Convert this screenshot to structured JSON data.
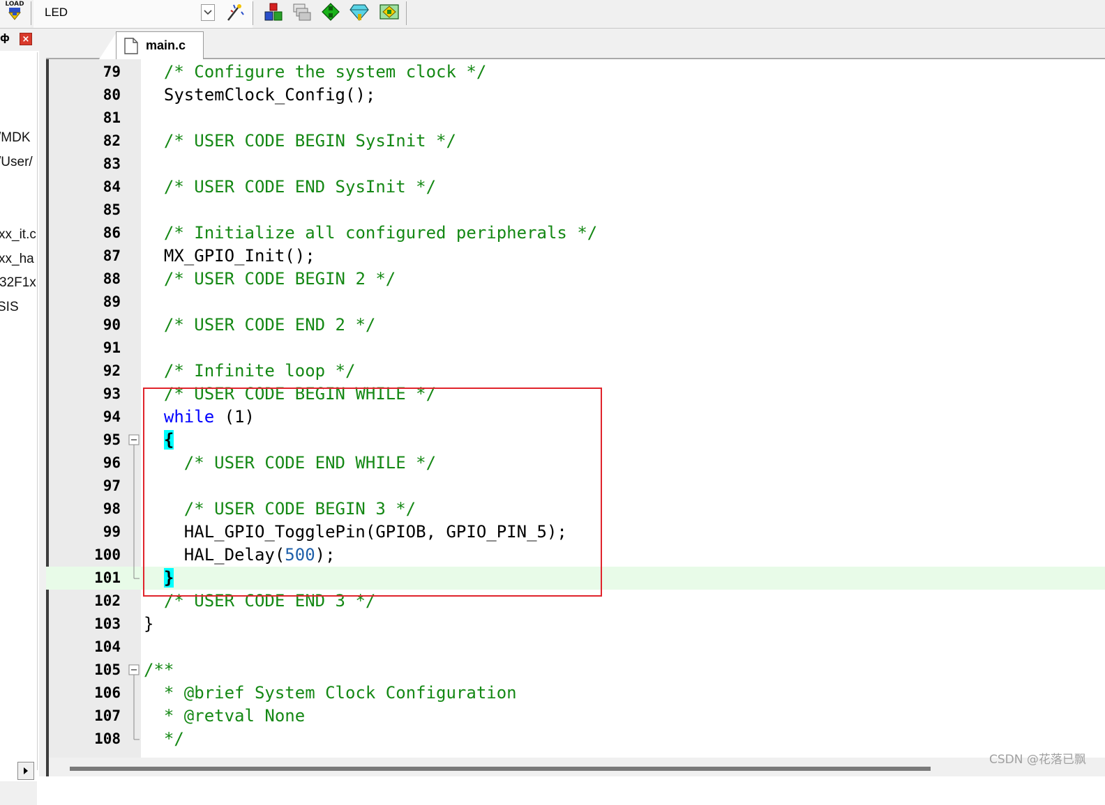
{
  "toolbar": {
    "load_label": "LOAD",
    "target_name": "LED"
  },
  "project_panel": {
    "items": [
      "/MDK",
      "/User/",
      "xx_it.c",
      "xx_ha",
      "32F1x",
      "SIS"
    ]
  },
  "editor": {
    "tab_label": "main.c",
    "lines": [
      {
        "n": "79",
        "indent": "  ",
        "text": "/* Configure the system clock */",
        "kind": "comment"
      },
      {
        "n": "80",
        "indent": "  ",
        "text": "SystemClock_Config();",
        "kind": "code"
      },
      {
        "n": "81",
        "indent": "",
        "text": "",
        "kind": "code"
      },
      {
        "n": "82",
        "indent": "  ",
        "text": "/* USER CODE BEGIN SysInit */",
        "kind": "comment"
      },
      {
        "n": "83",
        "indent": "",
        "text": "",
        "kind": "code"
      },
      {
        "n": "84",
        "indent": "  ",
        "text": "/* USER CODE END SysInit */",
        "kind": "comment"
      },
      {
        "n": "85",
        "indent": "",
        "text": "",
        "kind": "code"
      },
      {
        "n": "86",
        "indent": "  ",
        "text": "/* Initialize all configured peripherals */",
        "kind": "comment"
      },
      {
        "n": "87",
        "indent": "  ",
        "text": "MX_GPIO_Init();",
        "kind": "code"
      },
      {
        "n": "88",
        "indent": "  ",
        "text": "/* USER CODE BEGIN 2 */",
        "kind": "comment"
      },
      {
        "n": "89",
        "indent": "",
        "text": "",
        "kind": "code"
      },
      {
        "n": "90",
        "indent": "  ",
        "text": "/* USER CODE END 2 */",
        "kind": "comment"
      },
      {
        "n": "91",
        "indent": "",
        "text": "",
        "kind": "code"
      },
      {
        "n": "92",
        "indent": "  ",
        "text": "/* Infinite loop */",
        "kind": "comment"
      },
      {
        "n": "93",
        "indent": "  ",
        "text": "/* USER CODE BEGIN WHILE */",
        "kind": "comment"
      },
      {
        "n": "94",
        "indent": "  ",
        "kw": "while",
        "text": " (1)",
        "kind": "kw"
      },
      {
        "n": "95",
        "indent": "  ",
        "text": "{",
        "kind": "brace"
      },
      {
        "n": "96",
        "indent": "    ",
        "text": "/* USER CODE END WHILE */",
        "kind": "comment"
      },
      {
        "n": "97",
        "indent": "",
        "text": "",
        "kind": "code"
      },
      {
        "n": "98",
        "indent": "    ",
        "text": "/* USER CODE BEGIN 3 */",
        "kind": "comment"
      },
      {
        "n": "99",
        "indent": "    ",
        "text": "HAL_GPIO_TogglePin(GPIOB, GPIO_PIN_5);",
        "kind": "code"
      },
      {
        "n": "100",
        "indent": "    ",
        "pre": "HAL_Delay(",
        "num": "500",
        "post": ");",
        "kind": "num"
      },
      {
        "n": "101",
        "indent": "  ",
        "text": "}",
        "kind": "brace"
      },
      {
        "n": "102",
        "indent": "  ",
        "text": "/* USER CODE END 3 */",
        "kind": "comment"
      },
      {
        "n": "103",
        "indent": "",
        "text": "}",
        "kind": "code"
      },
      {
        "n": "104",
        "indent": "",
        "text": "",
        "kind": "code"
      },
      {
        "n": "105",
        "indent": "",
        "text": "/**",
        "kind": "comment"
      },
      {
        "n": "106",
        "indent": "  ",
        "text": "* @brief System Clock Configuration",
        "kind": "comment"
      },
      {
        "n": "107",
        "indent": "  ",
        "text": "* @retval None",
        "kind": "comment"
      },
      {
        "n": "108",
        "indent": "  ",
        "text": "*/",
        "kind": "comment"
      }
    ]
  },
  "colors": {
    "comment": "#148814",
    "keyword": "#0000ff",
    "number": "#1e5faa",
    "brace_highlight": "#00ffff",
    "current_line": "#e8fbe8",
    "annotation_box": "#e0232b"
  },
  "watermark": "CSDN @花落已飘"
}
